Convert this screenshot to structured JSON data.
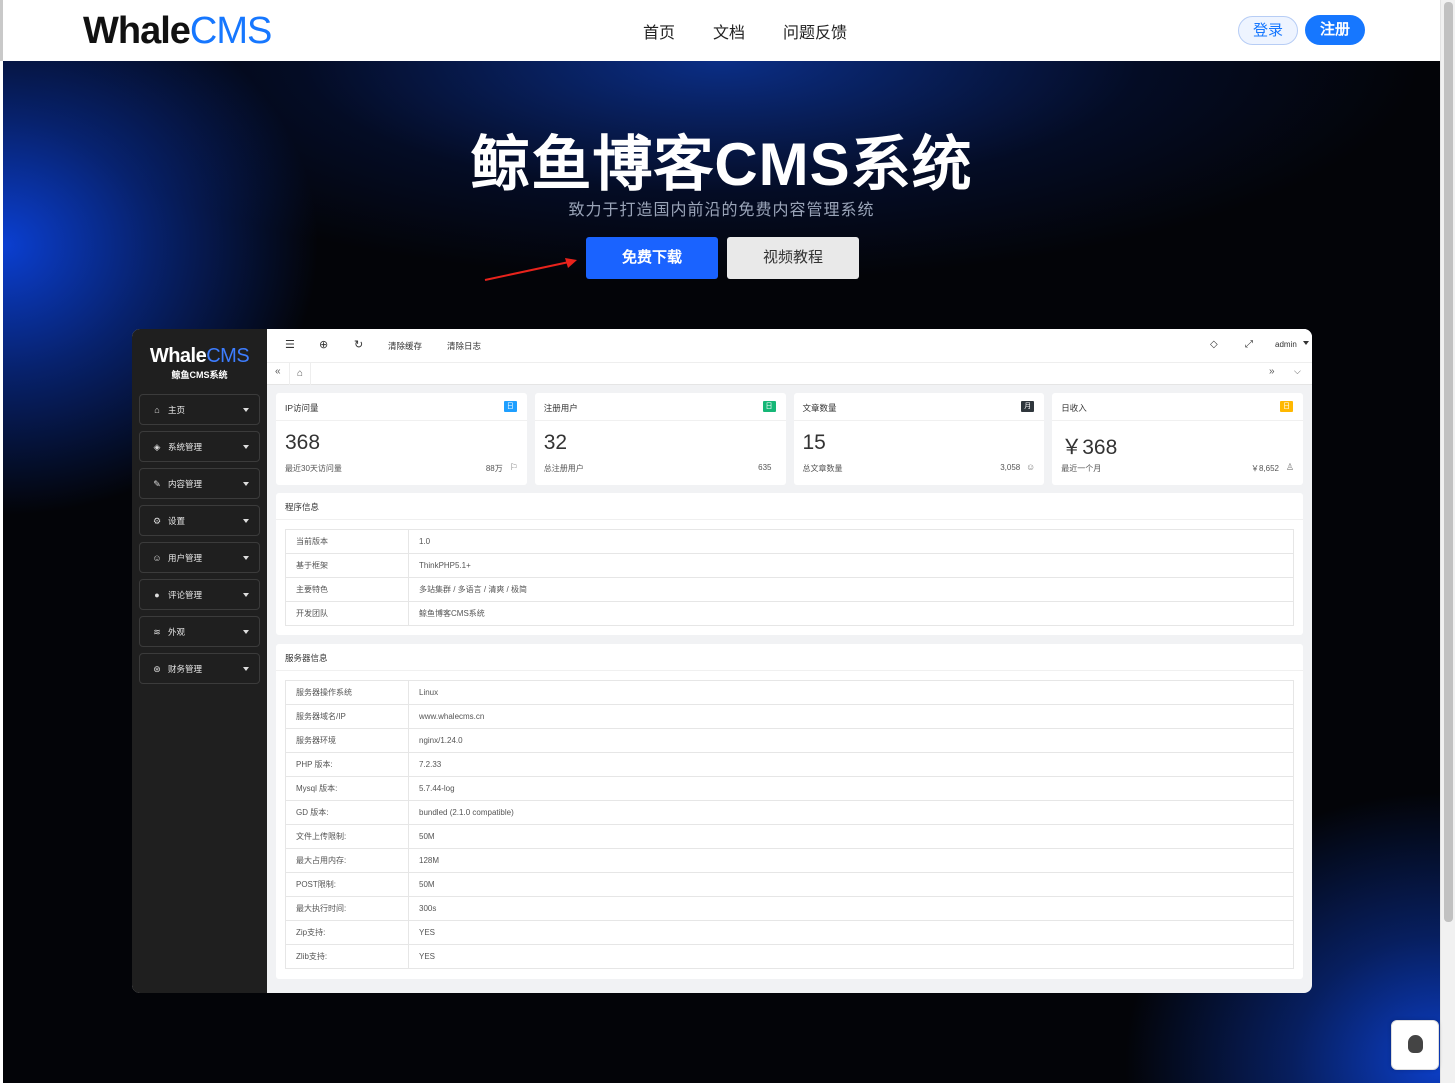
{
  "header": {
    "logo_main": "Whale",
    "logo_accent": "CMS",
    "nav": [
      "首页",
      "文档",
      "问题反馈"
    ],
    "login_label": "登录",
    "register_label": "注册"
  },
  "hero": {
    "title": "鲸鱼博客CMS系统",
    "subtitle": "致力于打造国内前沿的免费内容管理系统",
    "download_label": "免费下载",
    "video_label": "视频教程"
  },
  "admin": {
    "logo_main": "Whale",
    "logo_accent": "CMS",
    "logo_sub": "鲸鱼CMS系统",
    "menu": [
      {
        "label": "主页",
        "icon": "home-icon"
      },
      {
        "label": "系统管理",
        "icon": "shield-icon"
      },
      {
        "label": "内容管理",
        "icon": "edit-icon"
      },
      {
        "label": "设置",
        "icon": "gear-icon"
      },
      {
        "label": "用户管理",
        "icon": "user-icon"
      },
      {
        "label": "评论管理",
        "icon": "comment-icon"
      },
      {
        "label": "外观",
        "icon": "layers-icon"
      },
      {
        "label": "财务管理",
        "icon": "finance-icon"
      }
    ],
    "toolbar": {
      "clear_cache": "清除缓存",
      "clear_log": "清除日志",
      "user": "admin"
    },
    "cards": [
      {
        "title": "IP访问量",
        "badge": "日",
        "badge_color": "#1e9fff",
        "value": "368",
        "desc": "最近30天访问量",
        "total": "88万",
        "icon": "flag-icon"
      },
      {
        "title": "注册用户",
        "badge": "日",
        "badge_color": "#16b777",
        "value": "32",
        "desc": "总注册用户",
        "total": "635",
        "icon": ""
      },
      {
        "title": "文章数量",
        "badge": "月",
        "badge_color": "#2f363c",
        "value": "15",
        "desc": "总文章数量",
        "total": "3,058",
        "icon": "smile-icon"
      },
      {
        "title": "日收入",
        "badge": "日",
        "badge_color": "#ffb800",
        "value": "￥368",
        "desc": "最近一个月",
        "total": "￥8,652",
        "icon": "user-icon"
      }
    ],
    "program_info": {
      "title": "程序信息",
      "rows": [
        {
          "k": "当前版本",
          "v": "1.0"
        },
        {
          "k": "基于框架",
          "v": "ThinkPHP5.1+"
        },
        {
          "k": "主要特色",
          "v": "多站集群 / 多语言 / 清爽 / 极简"
        },
        {
          "k": "开发团队",
          "v": "鲸鱼博客CMS系统"
        }
      ]
    },
    "server_info": {
      "title": "服务器信息",
      "rows": [
        {
          "k": "服务器操作系统",
          "v": "Linux"
        },
        {
          "k": "服务器域名/IP",
          "v": "www.whalecms.cn"
        },
        {
          "k": "服务器环境",
          "v": "nginx/1.24.0"
        },
        {
          "k": "PHP 版本:",
          "v": "7.2.33"
        },
        {
          "k": "Mysql 版本:",
          "v": "5.7.44-log"
        },
        {
          "k": "GD 版本:",
          "v": "bundled (2.1.0 compatible)"
        },
        {
          "k": "文件上传限制:",
          "v": "50M"
        },
        {
          "k": "最大占用内存:",
          "v": "128M"
        },
        {
          "k": "POST限制:",
          "v": "50M"
        },
        {
          "k": "最大执行时间:",
          "v": "300s"
        },
        {
          "k": "Zip支持:",
          "v": "YES"
        },
        {
          "k": "Zlib支持:",
          "v": "YES"
        }
      ]
    }
  }
}
